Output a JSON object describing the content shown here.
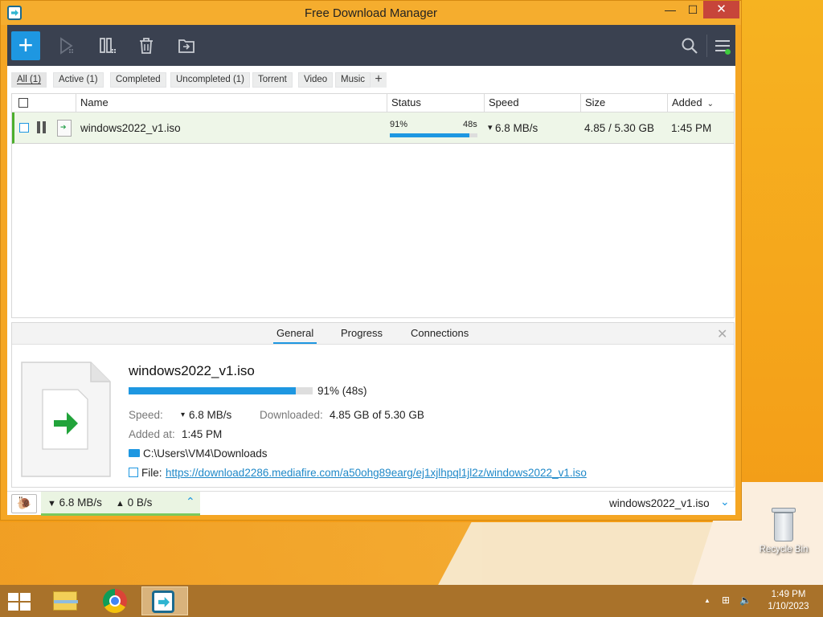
{
  "window": {
    "title": "Free Download Manager",
    "min_label": "—",
    "max_label": "☐",
    "close_label": "✕"
  },
  "toolbar": {
    "add_label": "+",
    "icons": [
      "add-download-icon",
      "resume-icon",
      "pause-icon",
      "delete-icon",
      "move-icon",
      "search-icon",
      "menu-icon"
    ]
  },
  "filters": {
    "tabs": [
      "All (1)",
      "Active (1)",
      "Completed",
      "Uncompleted (1)",
      "Torrent",
      "Video",
      "Music"
    ],
    "add_label": "+"
  },
  "table": {
    "columns": [
      "Name",
      "Status",
      "Speed",
      "Size",
      "Added"
    ],
    "sort_indicator": "⌄",
    "rows": [
      {
        "name": "windows2022_v1.iso",
        "status_percent": "91%",
        "status_eta": "48s",
        "progress": 0.91,
        "speed": "6.8 MB/s",
        "speed_arrow": "▾",
        "size": "4.85 / 5.30 GB",
        "added": "1:45 PM"
      }
    ]
  },
  "details": {
    "tabs": [
      "General",
      "Progress",
      "Connections"
    ],
    "close_label": "✕",
    "file_name": "windows2022_v1.iso",
    "progress": 0.91,
    "progress_text": "91% (48s)",
    "speed_label": "Speed:",
    "speed_value": "6.8 MB/s",
    "downloaded_label": "Downloaded:",
    "downloaded_value": "4.85 GB of 5.30 GB",
    "added_label": "Added at:",
    "added_value": "1:45 PM",
    "folder": "C:\\Users\\VM4\\Downloads",
    "file_label": "File:",
    "url": "https://download2286.mediafire.com/a50ohg89earg/ej1xjlhpql1jl2z/windows2022_v1.iso"
  },
  "statusbar": {
    "snail_label": "🐌",
    "down_speed": "6.8 MB/s",
    "up_speed": "0 B/s",
    "down_arrow": "▼",
    "up_arrow": "▲",
    "chevron_up": "⌃",
    "current_file": "windows2022_v1.iso",
    "chevron_down": "⌄"
  },
  "desktop": {
    "recycle_bin_label": "Recycle Bin"
  },
  "taskbar": {
    "time": "1:49 PM",
    "date": "1/10/2023",
    "tray_up": "▲",
    "tray_network": "⊞",
    "tray_volume": "🔈"
  },
  "colors": {
    "accent": "#1e97e1",
    "toolbar_bg": "#3a4150",
    "window_frame": "#f5a623",
    "active_row": "#eef6e8",
    "active_row_border": "#4caf2c",
    "close_button": "#c7453a"
  }
}
